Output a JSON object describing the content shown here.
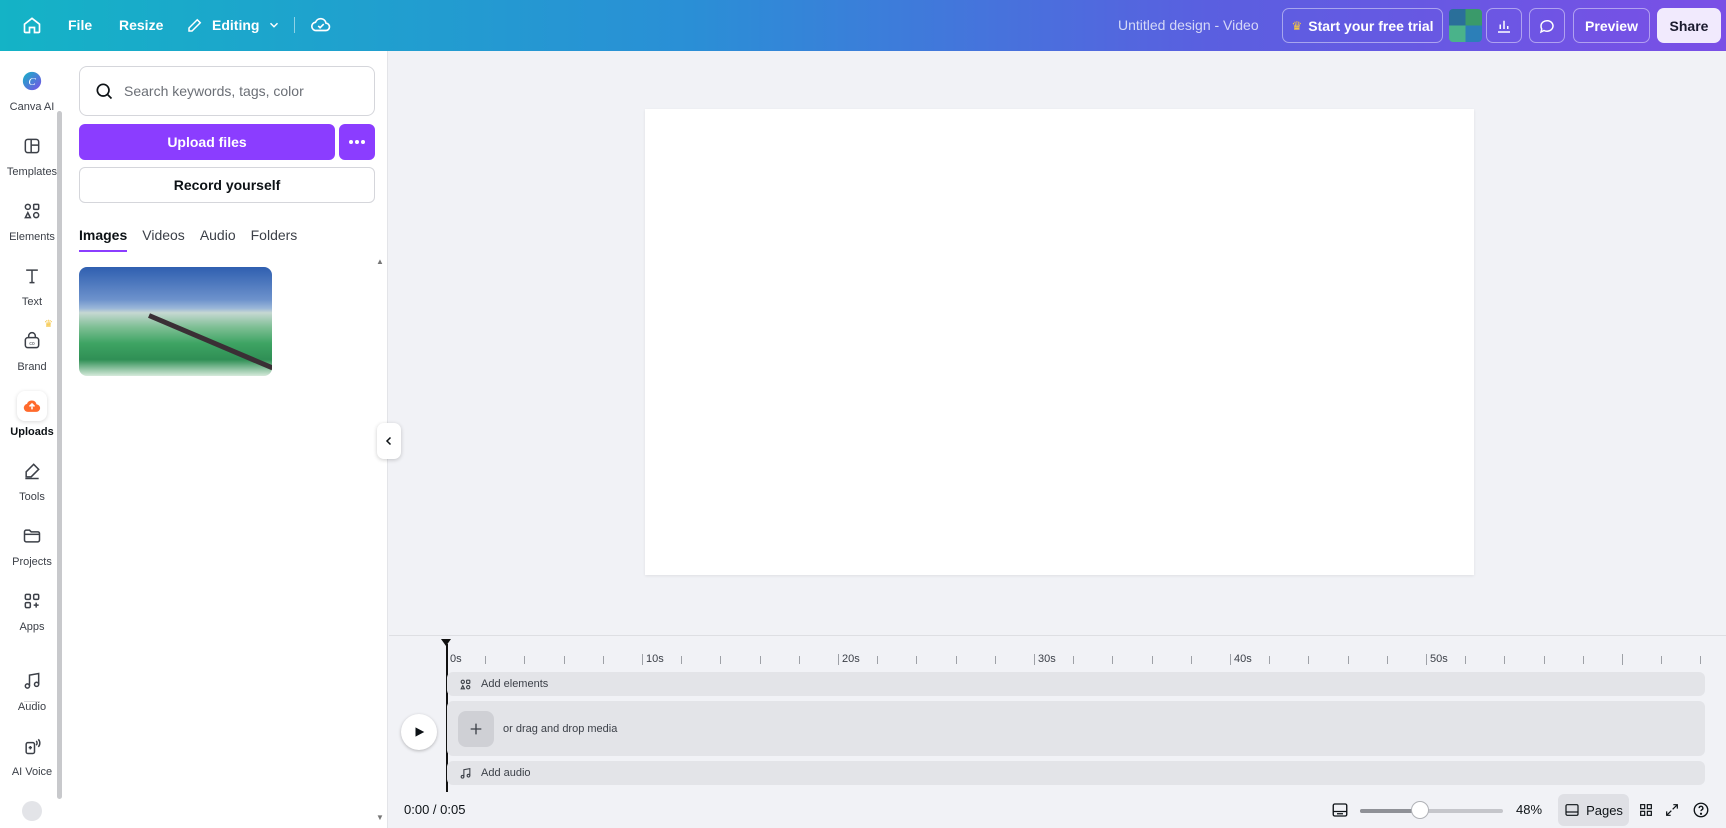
{
  "topbar": {
    "file": "File",
    "resize": "Resize",
    "editing": "Editing",
    "title": "Untitled design - Video",
    "trial": "Start your free trial",
    "preview": "Preview",
    "share": "Share"
  },
  "rail": {
    "items": [
      {
        "label": "Canva AI"
      },
      {
        "label": "Templates"
      },
      {
        "label": "Elements"
      },
      {
        "label": "Text"
      },
      {
        "label": "Brand"
      },
      {
        "label": "Uploads"
      },
      {
        "label": "Tools"
      },
      {
        "label": "Projects"
      },
      {
        "label": "Apps"
      },
      {
        "label": "Audio"
      },
      {
        "label": "AI Voice"
      }
    ]
  },
  "panel": {
    "search_placeholder": "Search keywords, tags, color",
    "upload": "Upload files",
    "record": "Record yourself",
    "tabs": [
      "Images",
      "Videos",
      "Audio",
      "Folders"
    ]
  },
  "timeline": {
    "ticks": [
      "0s",
      "10s",
      "20s",
      "30s",
      "40s",
      "50s"
    ],
    "add_elements": "Add elements",
    "drop_media": "or drag and drop media",
    "add_audio": "Add audio",
    "time": "0:00 / 0:05",
    "zoom": "48%",
    "zoom_level": 0.42,
    "pages": "Pages"
  },
  "colors": {
    "accent": "#8b3dff",
    "upload_icon": "#ff6a2c"
  }
}
